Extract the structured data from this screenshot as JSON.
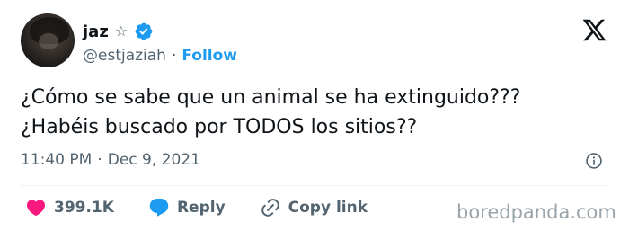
{
  "user": {
    "name": "jaz",
    "name_symbol": "☆",
    "handle": "@estjaziah",
    "separator": "·",
    "follow_label": "Follow"
  },
  "tweet": {
    "lines": [
      "¿Cómo se sabe que un animal se ha extinguido???",
      "¿Habéis buscado por TODOS los sitios??"
    ],
    "time": "11:40 PM",
    "meta_separator": "·",
    "date": "Dec 9, 2021"
  },
  "actions": {
    "like_count": "399.1K",
    "reply_label": "Reply",
    "copy_label": "Copy link"
  },
  "watermark": "boredpanda.com",
  "colors": {
    "accent": "#1d9bf0",
    "like": "#f91880",
    "muted": "#536471",
    "text": "#0f1419"
  },
  "icons": [
    "verified-badge-icon",
    "x-logo-icon",
    "info-icon",
    "heart-icon",
    "reply-bubble-icon",
    "link-icon"
  ]
}
